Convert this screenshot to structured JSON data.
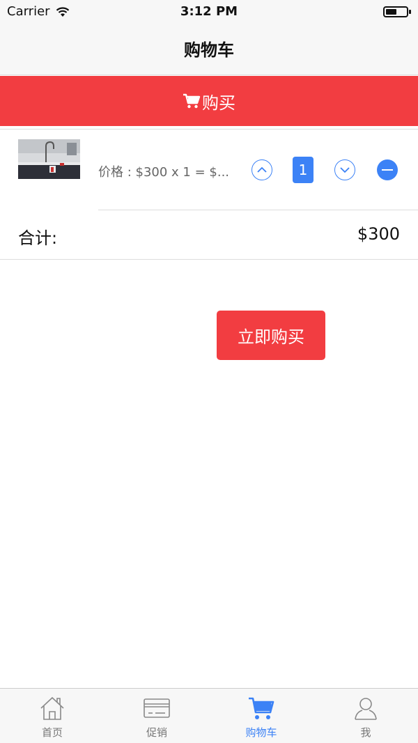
{
  "status_bar": {
    "carrier": "Carrier",
    "time": "3:12 PM",
    "battery_level": 0.55
  },
  "nav": {
    "title": "购物车"
  },
  "buy_banner": {
    "icon": "cart-icon",
    "label": "购买"
  },
  "cart": {
    "items": [
      {
        "image_icon": "product-thumbnail",
        "price_text": "价格 : $300 x 1 = $...",
        "quantity": "1"
      }
    ],
    "total_label": "合计:",
    "total_value": "$300"
  },
  "actions": {
    "buy_now_label": "立即购买"
  },
  "tab_bar": {
    "tabs": [
      {
        "label": "首页",
        "icon": "home-icon",
        "active": false
      },
      {
        "label": "促销",
        "icon": "card-icon",
        "active": false
      },
      {
        "label": "购物车",
        "icon": "cart-icon",
        "active": true
      },
      {
        "label": "我",
        "icon": "person-icon",
        "active": false
      }
    ]
  },
  "colors": {
    "accent_red": "#f23d41",
    "accent_blue": "#3c82f6",
    "inactive_gray": "#777777"
  }
}
